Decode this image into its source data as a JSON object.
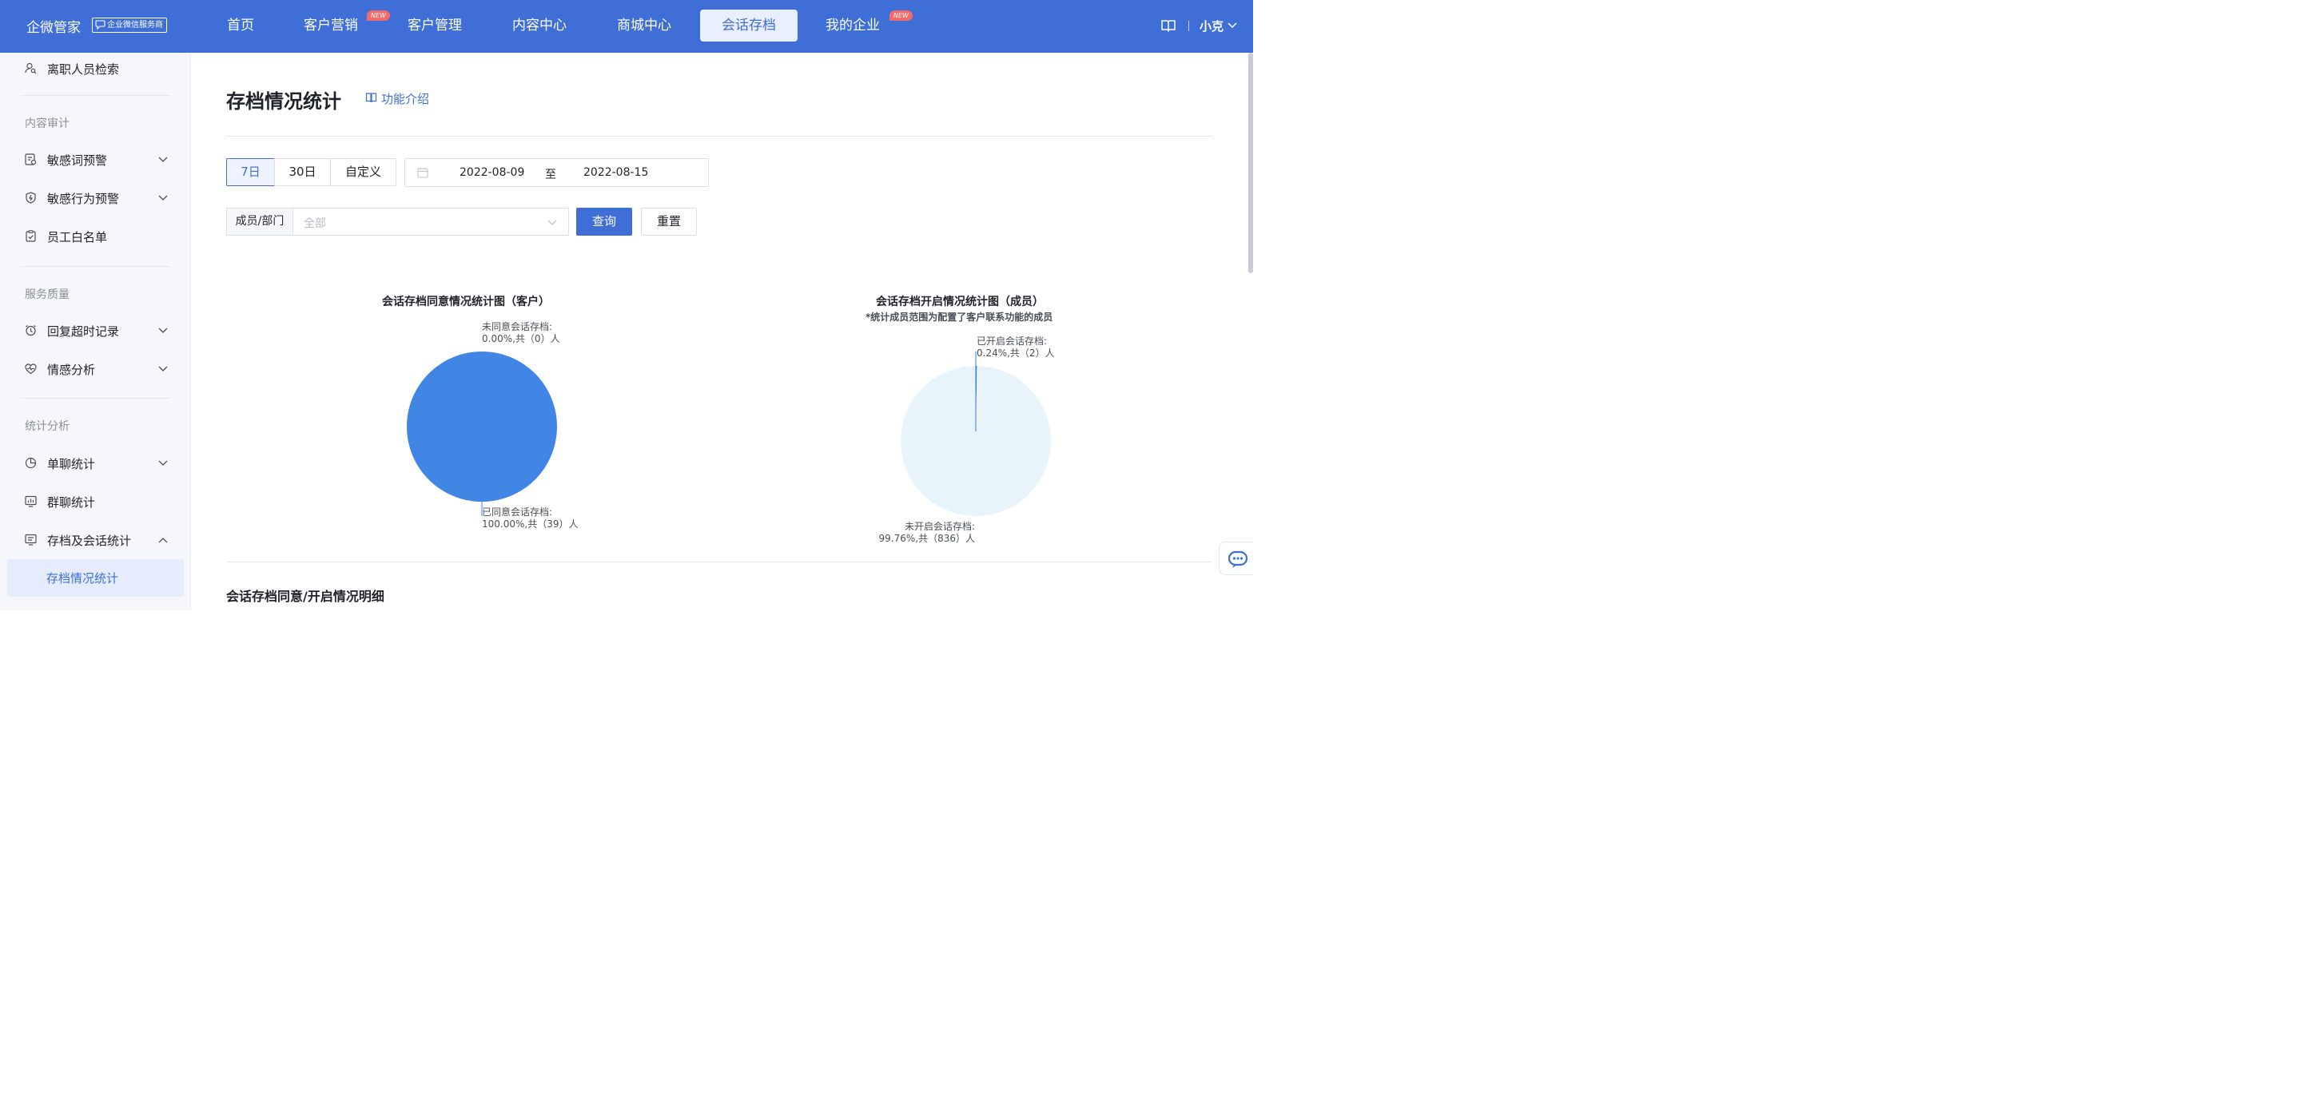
{
  "header": {
    "brand": "企微管家",
    "brand_badge": "企业微信服务商",
    "nav": [
      {
        "label": "首页"
      },
      {
        "label": "客户营销",
        "tag": "NEW"
      },
      {
        "label": "客户管理"
      },
      {
        "label": "内容中心"
      },
      {
        "label": "商城中心"
      },
      {
        "label": "会话存档",
        "active": true
      },
      {
        "label": "我的企业",
        "tag": "NEW"
      }
    ],
    "user": "小克"
  },
  "sidebar": {
    "items": [
      {
        "label": "离职人员检索",
        "icon": "user-search-icon"
      },
      {
        "label": "敏感词预警",
        "icon": "sensitive-word-icon",
        "expandable": true
      },
      {
        "label": "敏感行为预警",
        "icon": "sensitive-behavior-icon",
        "expandable": true
      },
      {
        "label": "员工白名单",
        "icon": "clipboard-check-icon"
      },
      {
        "label": "回复超时记录",
        "icon": "alarm-clock-icon",
        "expandable": true
      },
      {
        "label": "情感分析",
        "icon": "heart-pulse-icon",
        "expandable": true
      },
      {
        "label": "单聊统计",
        "icon": "pie-chart-icon",
        "expandable": true
      },
      {
        "label": "群聊统计",
        "icon": "monitor-chart-icon"
      },
      {
        "label": "存档及会话统计",
        "icon": "archive-list-icon",
        "expanded": true
      }
    ],
    "groups": [
      "内容审计",
      "服务质量",
      "统计分析"
    ],
    "active_sub": "存档情况统计"
  },
  "main": {
    "title": "存档情况统计",
    "intro_link": "功能介绍",
    "ranges": [
      "7日",
      "30日",
      "自定义"
    ],
    "active_range": "7日",
    "date_from": "2022-08-09",
    "date_sep": "至",
    "date_to": "2022-08-15",
    "member_label": "成员/部门",
    "member_placeholder": "全部",
    "query_button": "查询",
    "reset_button": "重置",
    "detail_title": "会话存档同意/开启情况明细"
  },
  "colors": {
    "primary": "#3f6fd6",
    "pie_agree": "#4286e5",
    "pie_disabled": "#e8f4fc"
  },
  "chart_data": [
    {
      "type": "pie",
      "title": "会话存档同意情况统计图（客户）",
      "slices": [
        {
          "name": "未同意会话存档",
          "percent": 0.0,
          "count": 0,
          "label_line1": "未同意会话存档:",
          "label_line2": "0.00%,共（0）人"
        },
        {
          "name": "已同意会话存档",
          "percent": 100.0,
          "count": 39,
          "label_line1": "已同意会话存档:",
          "label_line2": "100.00%,共（39）人"
        }
      ]
    },
    {
      "type": "pie",
      "title": "会话存档开启情况统计图（成员）",
      "subtitle": "*统计成员范围为配置了客户联系功能的成员",
      "slices": [
        {
          "name": "已开启会话存档",
          "percent": 0.24,
          "count": 2,
          "label_line1": "已开启会话存档:",
          "label_line2": "0.24%,共（2）人"
        },
        {
          "name": "未开启会话存档",
          "percent": 99.76,
          "count": 836,
          "label_line1": "未开启会话存档:",
          "label_line2": "99.76%,共（836）人"
        }
      ]
    }
  ]
}
